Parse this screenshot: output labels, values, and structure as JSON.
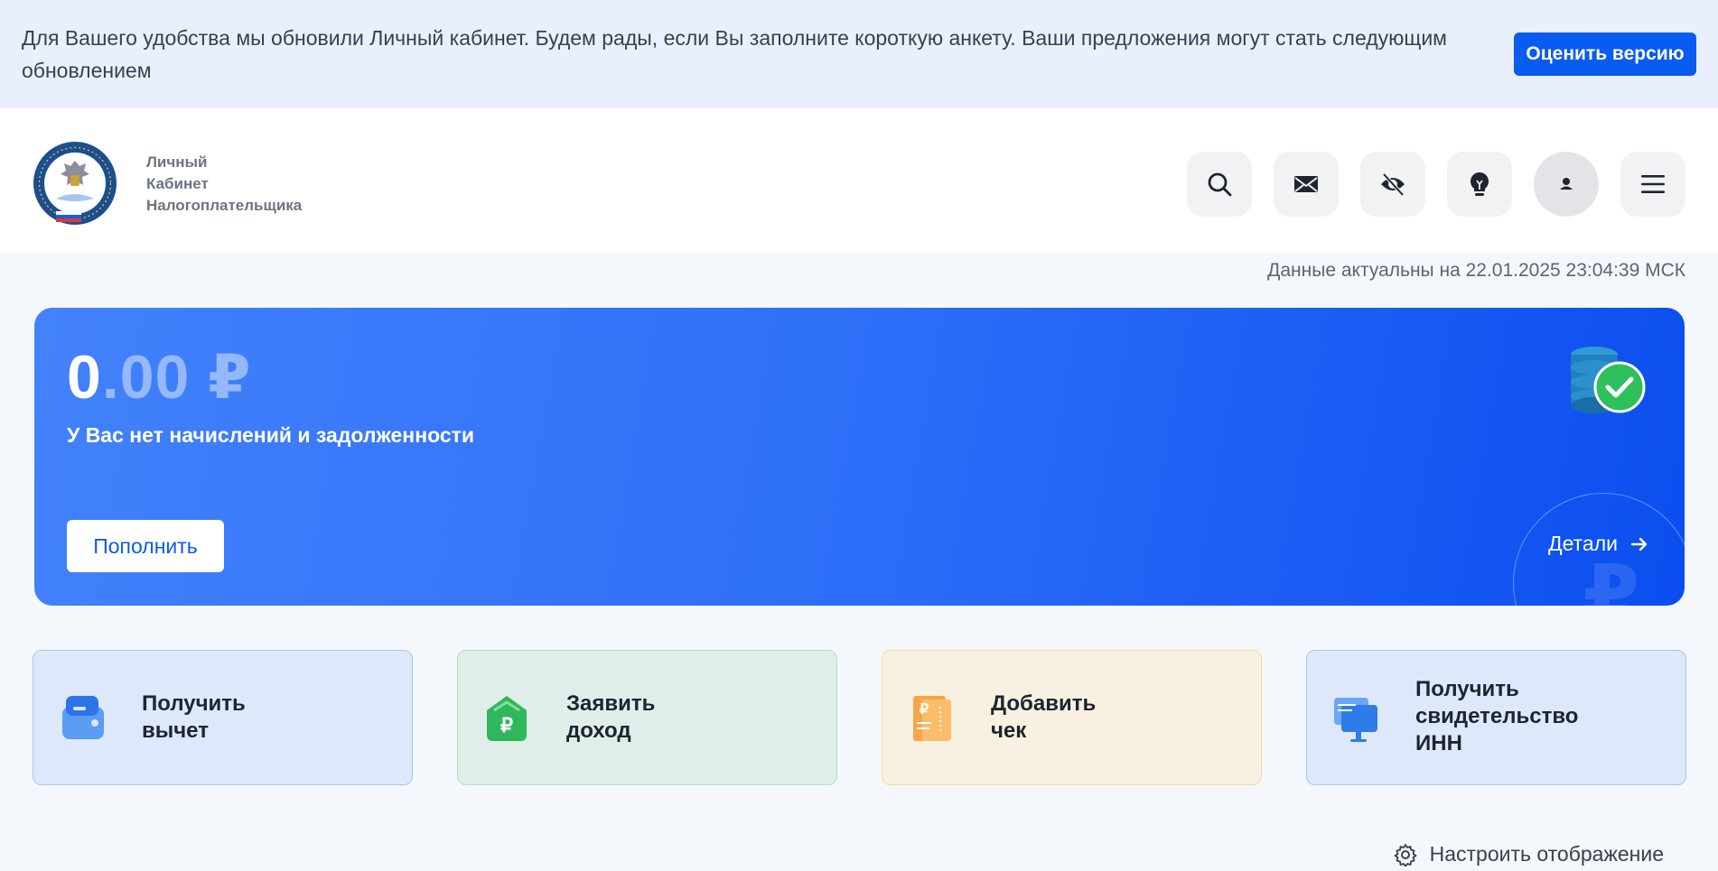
{
  "notice": {
    "text": "Для Вашего удобства мы обновили Личный кабинет. Будем рады, если Вы заполните короткую анкету. Ваши предложения могут стать следующим обновлением",
    "button": "Оценить версию"
  },
  "brand": {
    "line1": "Личный",
    "line2": "Кабинет",
    "line3": "Налогоплательщика"
  },
  "header_icons": [
    "search-icon",
    "mail-icon",
    "eye-off-icon",
    "lightbulb-icon",
    "user-icon",
    "menu-icon"
  ],
  "updated": "Данные актуальны на 22.01.2025 23:04:39 МСК",
  "balance": {
    "amount_whole": "0",
    "amount_fraction": ".00 ₽",
    "status": "У Вас нет начислений и задолженности",
    "topup": "Пополнить",
    "details": "Детали"
  },
  "actions": [
    {
      "line1": "Получить",
      "line2": "вычет",
      "line3": ""
    },
    {
      "line1": "Заявить",
      "line2": "доход",
      "line3": ""
    },
    {
      "line1": "Добавить",
      "line2": "чек",
      "line3": ""
    },
    {
      "line1": "Получить",
      "line2": "свидетельство",
      "line3": "ИНН"
    }
  ],
  "customize": "Настроить отображение",
  "colors": {
    "accent": "#0a5bf0",
    "banner": "#e9effc",
    "card_blue": "#dde8fb",
    "card_green": "#dfeee9",
    "card_yellow": "#f8f1e1"
  }
}
